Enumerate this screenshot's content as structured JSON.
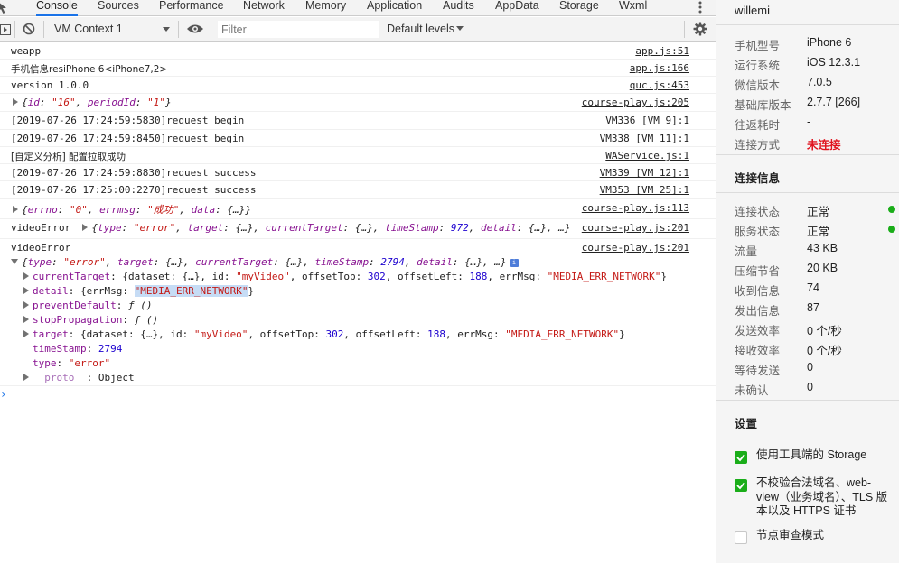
{
  "tabs": [
    "Console",
    "Sources",
    "Performance",
    "Network",
    "Memory",
    "Application",
    "Audits",
    "AppData",
    "Storage",
    "Wxml"
  ],
  "toolbar": {
    "context": "VM Context 1",
    "filter_placeholder": "Filter",
    "levels": "Default levels"
  },
  "console": {
    "rows": [
      {
        "text": "weapp",
        "src": "app.js:51"
      },
      {
        "text": "手机信息resiPhone 6<iPhone7,2>",
        "src": "app.js:166"
      },
      {
        "text": "version 1.0.0",
        "src": "quc.js:453"
      },
      {
        "text": "{id: \"16\", periodId: \"1\"}",
        "src": "course-play.js:205"
      },
      {
        "text": "[2019-07-26 17:24:59:5830]request begin",
        "src": "VM336 [VM 9]:1"
      },
      {
        "text": "[2019-07-26 17:24:59:8450]request begin",
        "src": "VM338 [VM 11]:1"
      },
      {
        "text": "[自定义分析] 配置拉取成功",
        "src": "WAService.js:1"
      },
      {
        "text": "[2019-07-26 17:24:59:8830]request success",
        "src": "VM339 [VM 12]:1"
      },
      {
        "text": "[2019-07-26 17:25:00:2270]request success",
        "src": "VM353 [VM 25]:1"
      },
      {
        "text": "{errno: \"0\", errmsg: \"成功\", data: {…}}",
        "src": "course-play.js:113"
      },
      {
        "text": "videoError",
        "src": "course-play.js:201"
      },
      {
        "text": "videoError",
        "src": "course-play.js:201"
      }
    ],
    "inline_obj": "{type: \"error\", target: {…}, currentTarget: {…}, timeStamp: 972, detail: {…}, …}",
    "expanded_header": "{type: \"error\", target: {…}, currentTarget: {…}, timeStamp: 2794, detail: {…}, …}",
    "props": [
      "currentTarget: {dataset: {…}, id: \"myVideo\", offsetTop: 302, offsetLeft: 188, errMsg: \"MEDIA_ERR_NETWORK\"}",
      "detail: {errMsg: \"MEDIA_ERR_NETWORK\"}",
      "preventDefault: ƒ ()",
      "stopPropagation: ƒ ()",
      "target: {dataset: {…}, id: \"myVideo\", offsetTop: 302, offsetLeft: 188, errMsg: \"MEDIA_ERR_NETWORK\"}",
      "timeStamp: 2794",
      "type: \"error\"",
      "__proto__: Object"
    ]
  },
  "side": {
    "title": "willemi",
    "device": [
      {
        "label": "手机型号",
        "value": "iPhone 6"
      },
      {
        "label": "运行系统",
        "value": "iOS 12.3.1"
      },
      {
        "label": "微信版本",
        "value": "7.0.5"
      },
      {
        "label": "基础库版本",
        "value": "2.7.7 [266]"
      },
      {
        "label": "往返耗时",
        "value": "-"
      },
      {
        "label": "连接方式",
        "value": "未连接"
      }
    ],
    "conn_title": "连接信息",
    "conn": [
      {
        "label": "连接状态",
        "value": "正常"
      },
      {
        "label": "服务状态",
        "value": "正常"
      },
      {
        "label": "流量",
        "value": "43 KB"
      },
      {
        "label": "压缩节省",
        "value": "20 KB"
      },
      {
        "label": "收到信息",
        "value": "74"
      },
      {
        "label": "发出信息",
        "value": "87"
      },
      {
        "label": "发送效率",
        "value": "0 个/秒"
      },
      {
        "label": "接收效率",
        "value": "0 个/秒"
      },
      {
        "label": "等待发送",
        "value": "0"
      },
      {
        "label": "未确认",
        "value": "0"
      }
    ],
    "settings_title": "设置",
    "settings": [
      {
        "label": "使用工具端的 Storage",
        "checked": true
      },
      {
        "label": "不校验合法域名、web-view（业务域名）、TLS 版本以及 HTTPS 证书",
        "checked": true
      },
      {
        "label": "节点审查模式",
        "checked": false
      }
    ]
  }
}
